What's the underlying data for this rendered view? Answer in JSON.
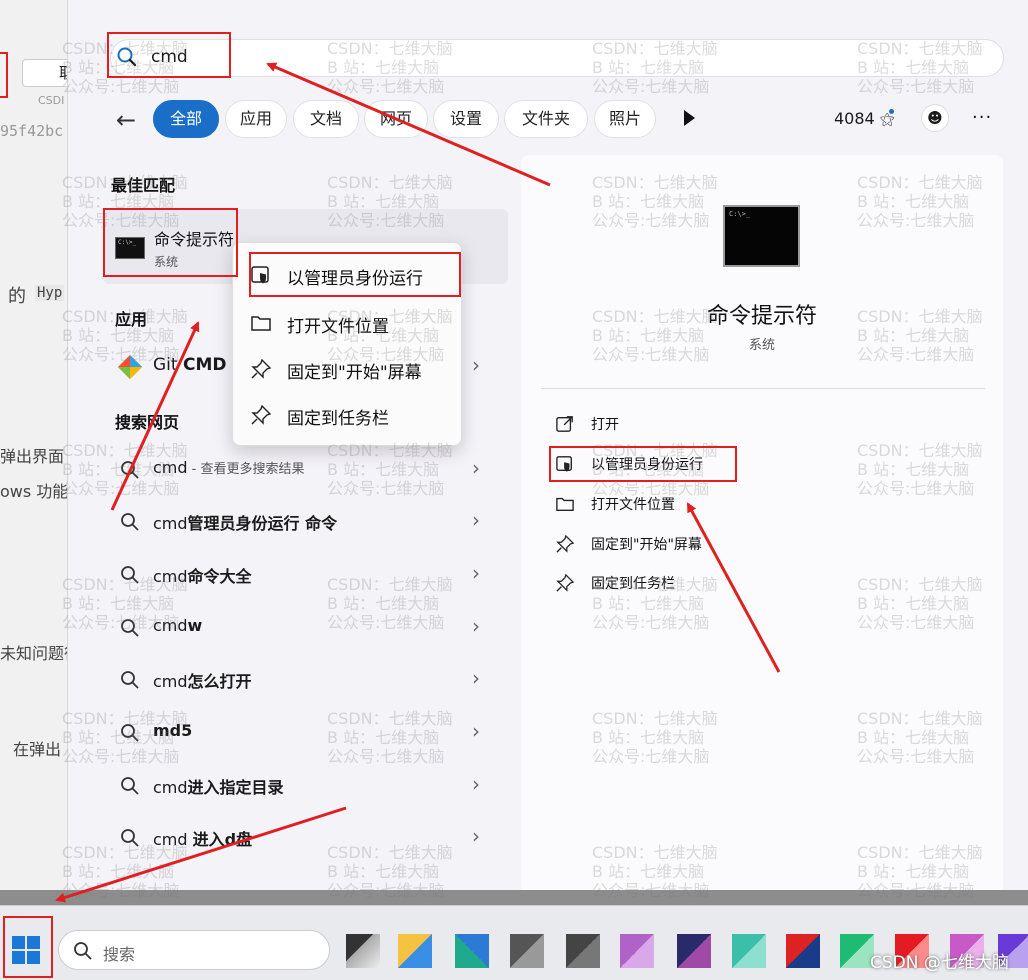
{
  "background": {
    "button_text": "取",
    "csdn_text": "CSDI",
    "hash_text": "95f42bc",
    "line1": "的",
    "line1_code": "Hyp",
    "line2": "弹出界面",
    "line3": "ows 功能",
    "line4": "未知问题很",
    "line5": "在弹出"
  },
  "search": {
    "value": "cmd"
  },
  "filters": {
    "back_icon": "back-arrow-icon",
    "chips": [
      "全部",
      "应用",
      "文档",
      "网页",
      "设置",
      "文件夹",
      "照片"
    ],
    "points": "4084",
    "more": "···"
  },
  "best_match": {
    "heading": "最佳匹配",
    "title": "命令提示符",
    "subtitle": "系统"
  },
  "apps": {
    "heading": "应用",
    "item_prefix": "Git ",
    "item_bold": "CMD"
  },
  "web": {
    "heading": "搜索网页",
    "first_query": "cmd",
    "first_hint": " - 查看更多搜索结果",
    "items": [
      {
        "plain": "cmd",
        "bold": "管理员身份运行 命令"
      },
      {
        "plain": "cmd",
        "bold": "命令大全"
      },
      {
        "plain": "cmd",
        "bold": "w"
      },
      {
        "plain": "cmd",
        "bold": "怎么打开"
      },
      {
        "plain": "",
        "bold": "md5"
      },
      {
        "plain": "cmd",
        "bold": "进入指定目录"
      },
      {
        "plain": "cmd ",
        "bold": "进入d盘"
      }
    ]
  },
  "context_menu": {
    "items": [
      "以管理员身份运行",
      "打开文件位置",
      "固定到\"开始\"屏幕",
      "固定到任务栏"
    ]
  },
  "detail": {
    "title": "命令提示符",
    "subtitle": "系统",
    "actions": [
      "打开",
      "以管理员身份运行",
      "打开文件位置",
      "固定到\"开始\"屏幕",
      "固定到任务栏"
    ]
  },
  "watermark": {
    "line1": "CSDN：七维大脑",
    "line2": "B 站：七维大脑",
    "line3": "公众号:七维大脑"
  },
  "taskbar": {
    "search_placeholder": "搜索",
    "corner_text": "CSDN @七维大脑"
  },
  "colors": {
    "accent": "#1a6ec8",
    "annotation_red": "#e02020"
  }
}
